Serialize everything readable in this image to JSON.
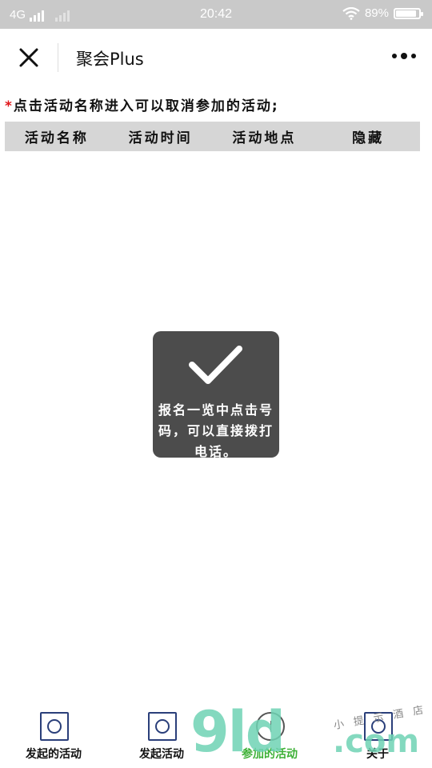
{
  "status_bar": {
    "network": "4G",
    "time": "20:42",
    "battery_percent": "89%",
    "battery_level": 0.89
  },
  "nav": {
    "title": "聚会Plus",
    "close_icon": "close-icon",
    "more_icon": "more-icon"
  },
  "hint": {
    "star": "*",
    "text": "点击活动名称进入可以取消参加的活动;"
  },
  "table": {
    "headers": [
      "活动名称",
      "活动时间",
      "活动地点",
      "隐藏"
    ]
  },
  "toast": {
    "icon": "checkmark-icon",
    "message": "报名一览中点击号码，可以直接拨打电话。"
  },
  "tabs": [
    {
      "label": "发起的活动",
      "icon": "tab-icon"
    },
    {
      "label": "发起活动",
      "icon": "tab-icon"
    },
    {
      "label": "参加的活动",
      "icon": "tab-icon",
      "active": true
    },
    {
      "label": "关于",
      "icon": "tab-icon"
    }
  ],
  "watermark": {
    "big": "9ld",
    "com": ".com",
    "small": "小 提 示 酒 店"
  },
  "colors": {
    "accent_green": "#3cb035",
    "required_star": "#e0161a",
    "toast_bg": "#4c4c4c",
    "tab_icon": "#2a3f7a"
  }
}
